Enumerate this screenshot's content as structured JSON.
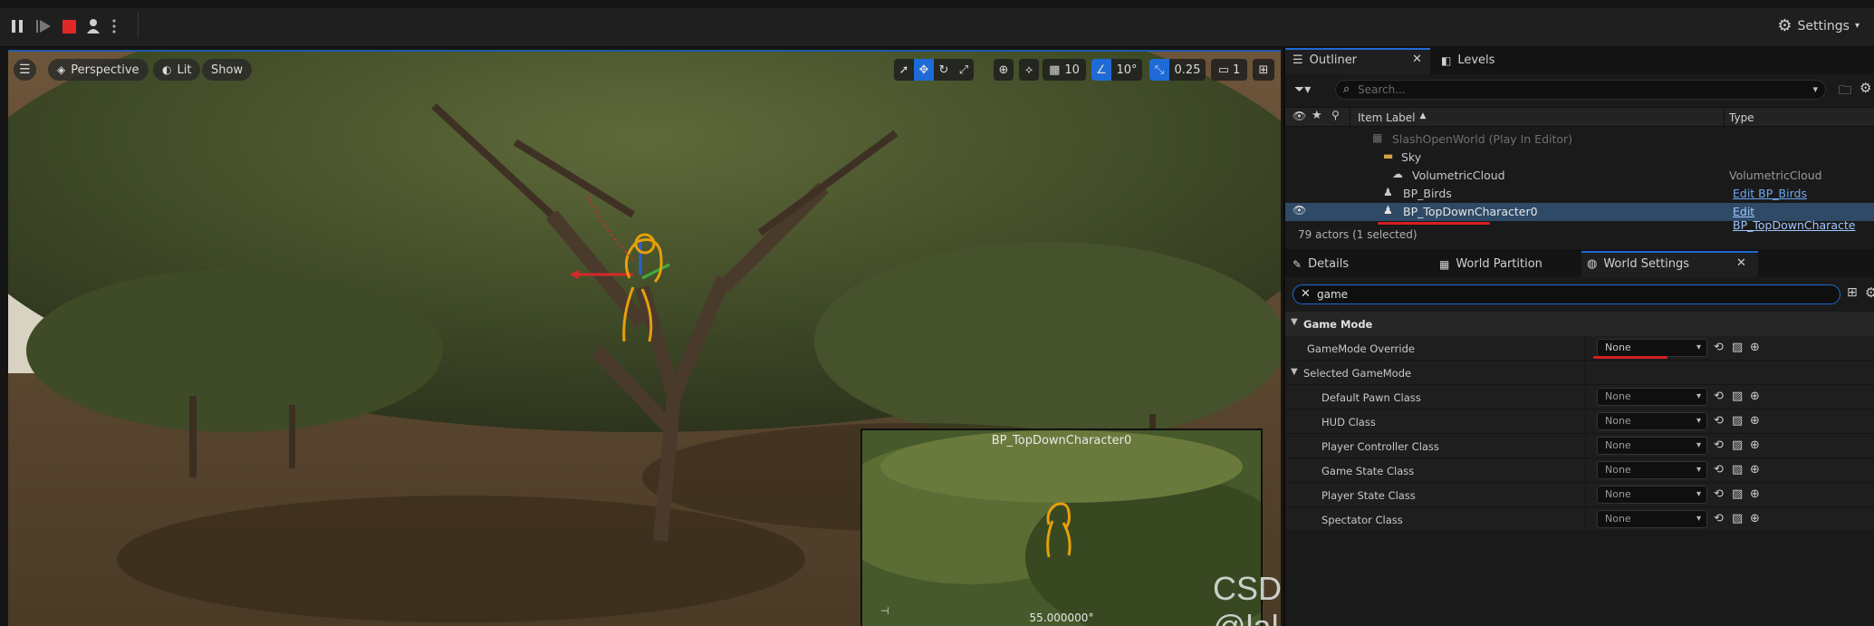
{
  "toolbar": {
    "settings_label": "Settings"
  },
  "viewport": {
    "view_mode": "Perspective",
    "lighting": "Lit",
    "show_label": "Show",
    "grid_snap": "10",
    "rotation_snap": "10°",
    "scale_snap": "0.25",
    "camera_speed": "1",
    "pip_title": "BP_TopDownCharacter0",
    "pip_fov": "55.000000°",
    "watermark": "CSDN @lalapanda"
  },
  "outliner": {
    "tab_outliner": "Outliner",
    "tab_levels": "Levels",
    "search_placeholder": "Search...",
    "col_item_label": "Item Label",
    "col_type": "Type",
    "rows": [
      {
        "label": "SlashOpenWorld (Play In Editor)",
        "type": ""
      },
      {
        "label": "Sky",
        "type": ""
      },
      {
        "label": "VolumetricCloud",
        "type": "VolumetricCloud"
      },
      {
        "label": "BP_Birds",
        "type": "Edit BP_Birds"
      },
      {
        "label": "BP_TopDownCharacter0",
        "type": "Edit BP_TopDownCharacte"
      }
    ],
    "actor_count": "79 actors (1 selected)"
  },
  "details": {
    "tab_details": "Details",
    "tab_world_partition": "World Partition",
    "tab_world_settings": "World Settings",
    "search_value": "game",
    "section_game_mode": "Game Mode",
    "gamemode_override_label": "GameMode Override",
    "gamemode_override_value": "None",
    "selected_gamemode_label": "Selected GameMode",
    "props": [
      {
        "label": "Default Pawn Class",
        "value": "None"
      },
      {
        "label": "HUD Class",
        "value": "None"
      },
      {
        "label": "Player Controller Class",
        "value": "None"
      },
      {
        "label": "Game State Class",
        "value": "None"
      },
      {
        "label": "Player State Class",
        "value": "None"
      },
      {
        "label": "Spectator Class",
        "value": "None"
      }
    ]
  },
  "colors": {
    "accent_blue": "#1e6ad6",
    "selection_red": "#d32020",
    "highlight_yellow": "#e6a00a"
  }
}
